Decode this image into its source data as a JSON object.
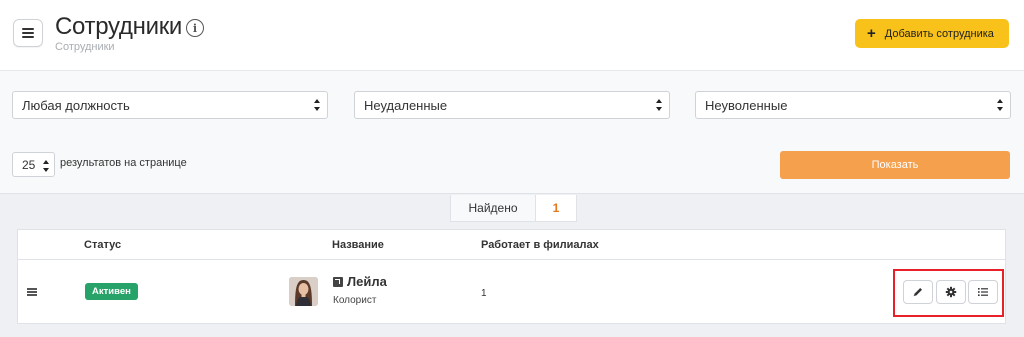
{
  "header": {
    "title": "Сотрудники",
    "breadcrumb": "Сотрудники",
    "add_button": {
      "icon": "plus-icon",
      "label": "Добавить сотрудника"
    }
  },
  "filters": {
    "position": {
      "selected": "Любая должность"
    },
    "deleted": {
      "selected": "Неудаленные"
    },
    "fired": {
      "selected": "Неуволенные"
    },
    "per_page": {
      "selected": "25",
      "label": "результатов на странице"
    },
    "show_button": "Показать"
  },
  "results": {
    "found_label": "Найдено",
    "count": "1"
  },
  "table": {
    "columns": [
      "Статус",
      "Название",
      "Работает в филиалах"
    ],
    "rows": [
      {
        "status": "Активен",
        "name": "Лейла",
        "role": "Колорист",
        "branches": "1",
        "actions": [
          "pencil-icon",
          "gear-icon",
          "list-icon"
        ]
      }
    ]
  },
  "colors": {
    "accent_yellow": "#f8c21b",
    "show_orange": "#f5a04d",
    "active_green": "#27a36a",
    "found_orange": "#e4781c",
    "highlight_red": "#e8202a"
  }
}
